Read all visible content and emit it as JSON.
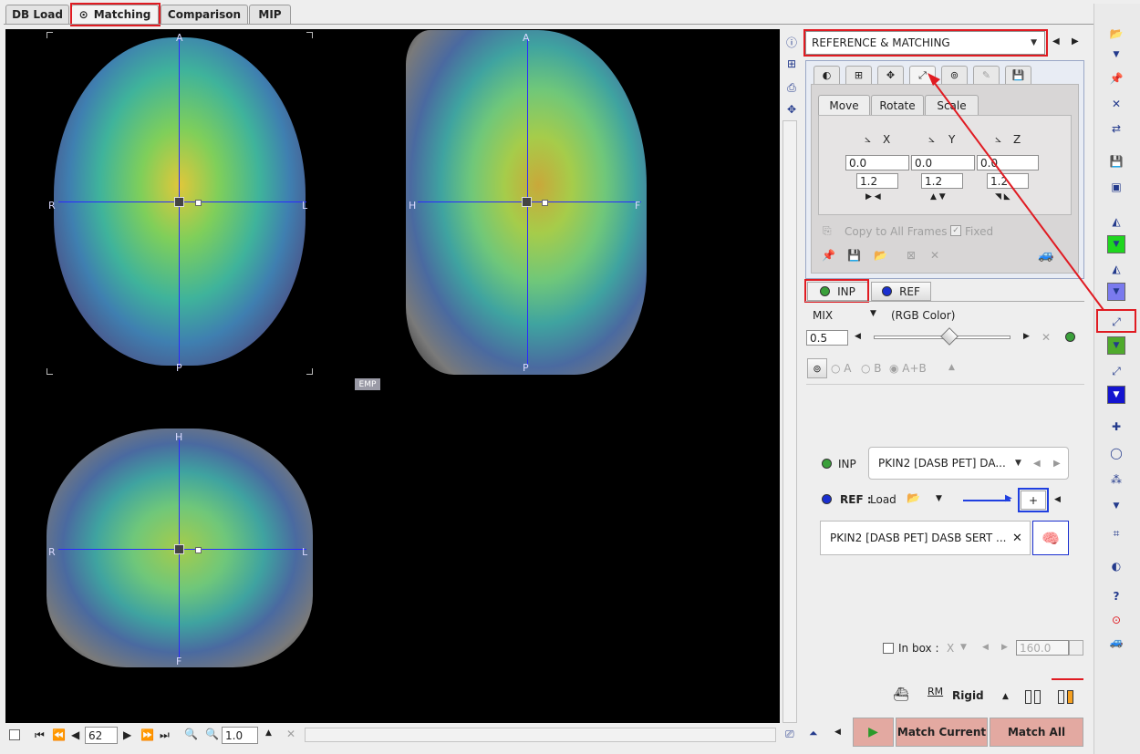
{
  "tabs": [
    {
      "label": "DB Load"
    },
    {
      "label": "Matching",
      "icon": "radio-target-icon"
    },
    {
      "label": "Comparison"
    },
    {
      "label": "MIP"
    }
  ],
  "viewer": {
    "axial": {
      "top": "A",
      "bottom": "P",
      "left": "R",
      "right": "L"
    },
    "sagittal": {
      "top": "A",
      "bottom": "P",
      "left": "H",
      "right": "F"
    },
    "coronal": {
      "top": "H",
      "bottom": "F",
      "left": "R",
      "right": "L"
    },
    "badge": "EMP"
  },
  "bottom_bar": {
    "slice": "62",
    "zoom": "1.0"
  },
  "panel": {
    "mode_select": "REFERENCE & MATCHING",
    "subtabs": [
      "Move",
      "Rotate",
      "Scale"
    ],
    "axes": {
      "x": "X",
      "y": "Y",
      "z": "Z"
    },
    "move_values": [
      "0.0",
      "0.0",
      "0.0"
    ],
    "step_values": [
      "1.2",
      "1.2",
      "1.2"
    ],
    "copy_frames": "Copy to All Frames",
    "fixed": "Fixed",
    "inp_tab": "INP",
    "ref_tab": "REF",
    "mix_label": "MIX",
    "mix_mode": "(RGB Color)",
    "mix_value": "0.5",
    "mix_fraction": 0.55,
    "radio_a": "A",
    "radio_b": "B",
    "radio_ab": "A+B",
    "inp_label": "INP",
    "inp_series": "PKIN2 [DASB PET] DA...",
    "ref_label": "REF :",
    "ref_load": "Load",
    "ref_series": "PKIN2 [DASB PET] DASB SERT ...",
    "in_box": "In box :",
    "in_box_axis": "X",
    "in_box_value": "160.0",
    "rigid": "Rigid",
    "rm_label": "RM",
    "match_current": "Match Current",
    "match_all": "Match All"
  },
  "colors": {
    "accent_red": "#e01b22",
    "inp_green": "#3aa03a",
    "ref_blue": "#1a2fd0",
    "match_button": "#e3a9a1"
  }
}
